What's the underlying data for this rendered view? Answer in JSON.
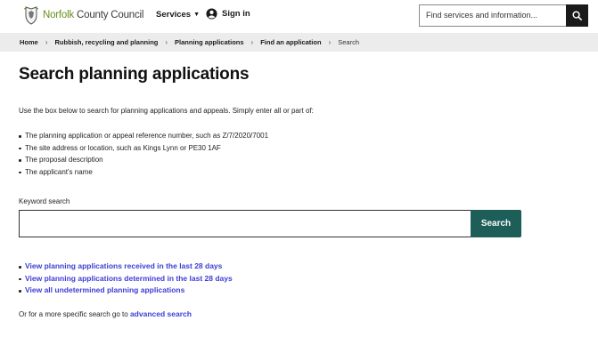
{
  "header": {
    "logo": {
      "brand": "Norfolk",
      "suffix": "County Council"
    },
    "services_label": "Services",
    "signin_label": "Sign in",
    "search_placeholder": "Find services and information..."
  },
  "breadcrumb": [
    {
      "label": "Home"
    },
    {
      "label": "Rubbish, recycling and planning"
    },
    {
      "label": "Planning applications"
    },
    {
      "label": "Find an application"
    },
    {
      "label": "Search"
    }
  ],
  "page": {
    "title": "Search planning applications",
    "intro": "Use the box below to search for planning applications and appeals. Simply enter all or part of:",
    "bullets": [
      "The planning application or appeal reference number, such as Z/7/2020/7001",
      "The site address or location, such as Kings Lynn or PE30 1AF",
      "The proposal description",
      "The applicant's name"
    ],
    "keyword_label": "Keyword search",
    "keyword_value": "",
    "search_button": "Search",
    "links": [
      "View planning applications received in the last 28 days",
      "View planning applications determined in the last 28 days",
      "View all undetermined planning applications"
    ],
    "advanced_prefix": "Or for a more specific search go to",
    "advanced_link": "advanced search"
  },
  "icons": {
    "logo": "norfolk-crest-icon",
    "account": "account-icon",
    "search": "search-icon",
    "caret": "caret-down-icon",
    "chevron": "chevron-right-icon"
  },
  "colors": {
    "brand_green": "#6a8f1f",
    "search_button": "#1d5e59",
    "link": "#3d3dd6",
    "breadcrumb_bg": "#ececec"
  }
}
